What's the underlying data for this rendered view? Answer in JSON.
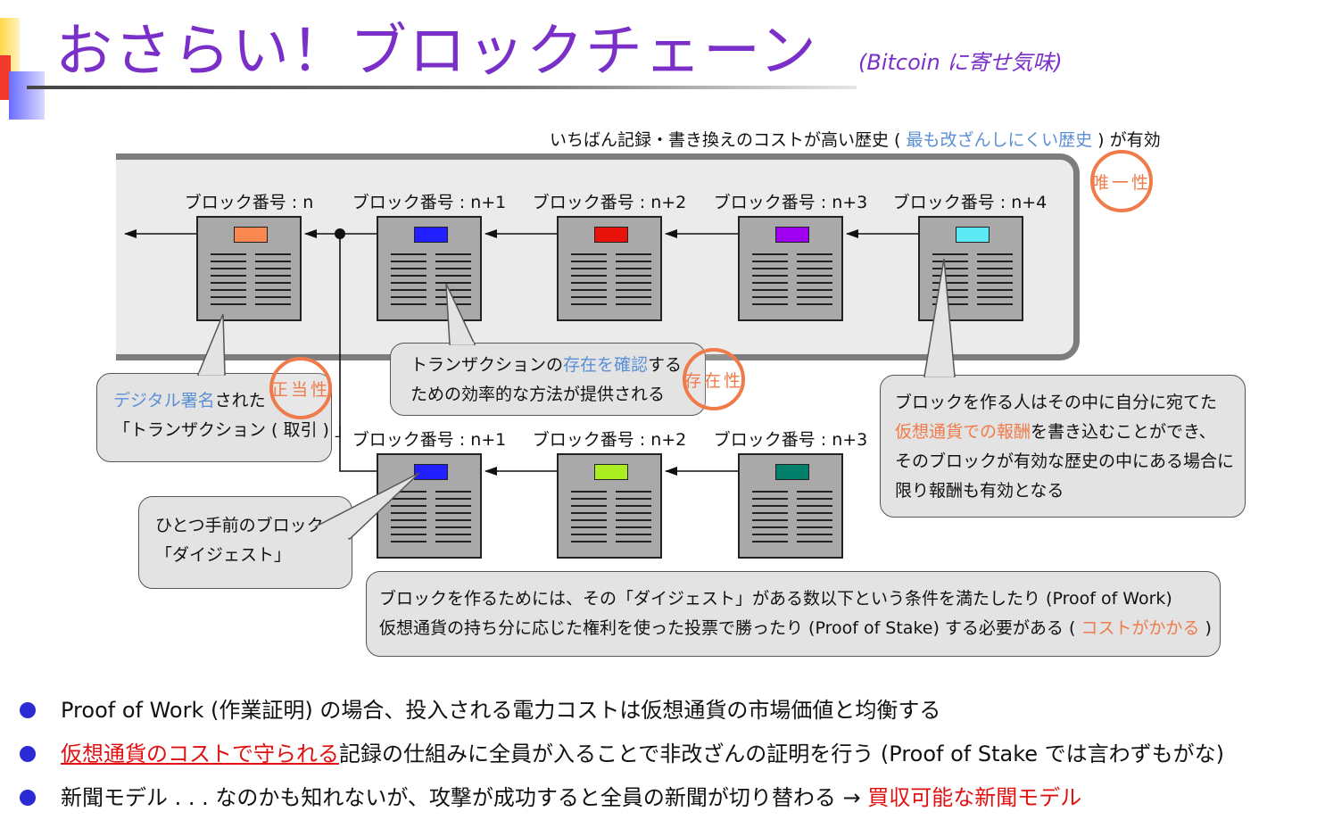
{
  "slide": {
    "title": "おさらい！ブロックチェーン",
    "subtitle": "(Bitcoin に寄せ気味)"
  },
  "top_note": {
    "prefix": "いちばん記録・書き換えのコストが高い歴史 ( ",
    "highlight": "最も改ざんしにくい歴史",
    "suffix": " ) が有効"
  },
  "main_chain": [
    {
      "label": "ブロック番号 : n",
      "hash_color": "#f9874f"
    },
    {
      "label": "ブロック番号 : n+1",
      "hash_color": "#1f1fff"
    },
    {
      "label": "ブロック番号 : n+2",
      "hash_color": "#e8120a"
    },
    {
      "label": "ブロック番号 : n+3",
      "hash_color": "#a000f0"
    },
    {
      "label": "ブロック番号 : n+4",
      "hash_color": "#5ce8f5"
    }
  ],
  "fork_chain": [
    {
      "label": "ブロック番号 : n+1",
      "hash_color": "#1f1fff"
    },
    {
      "label": "ブロック番号 : n+2",
      "hash_color": "#aaee22"
    },
    {
      "label": "ブロック番号 : n+3",
      "hash_color": "#00806a"
    }
  ],
  "badges": {
    "uniqueness": "唯一性",
    "legitimacy": "正当性",
    "existence": "存在性"
  },
  "callouts": {
    "signature": {
      "line1_highlight": "デジタル署名",
      "line1_rest": "された",
      "line2": "「トランザクション ( 取引 ) 」"
    },
    "transaction": {
      "line1_prefix": "トランザクションの",
      "line1_highlight": "存在を確認",
      "line1_suffix": "する",
      "line2": "ための効率的な方法が提供される"
    },
    "digest": {
      "line1": "ひとつ手前のブロックの",
      "line2": "「ダイジェスト」"
    },
    "reward": {
      "line1": "ブロックを作る人はその中に自分に宛てた",
      "line2_highlight": "仮想通貨での報酬",
      "line2_rest": "を書き込むことができ、",
      "line3": "そのブロックが有効な歴史の中にある場合に",
      "line4": "限り報酬も有効となる"
    },
    "consensus": {
      "line1": "ブロックを作るためには、その「ダイジェスト」がある数以下という条件を満たしたり (Proof of Work)",
      "line2_prefix": "仮想通貨の持ち分に応じた権利を使った投票で勝ったり (Proof of Stake) する必要がある ( ",
      "line2_highlight": "コストがかかる",
      "line2_suffix": " )"
    }
  },
  "bullets": [
    {
      "text": "Proof of Work (作業証明) の場合、投入される電力コストは仮想通貨の市場価値と均衡する"
    },
    {
      "highlight": "仮想通貨のコストで守られる",
      "rest": "記録の仕組みに全員が入ることで非改ざんの証明を行う (Proof of Stake では言わずもがな)"
    },
    {
      "prefix": "新聞モデル . . . なのかも知れないが、攻撃が成功すると全員の新聞が切り替わる → ",
      "highlight": "買収可能な新聞モデル"
    }
  ],
  "colors": {
    "title": "#7b2fc9",
    "accent_blue": "#5b8fd6",
    "accent_orange": "#f07b4a",
    "accent_red": "#e01010",
    "bullet": "#2b2bd6"
  }
}
